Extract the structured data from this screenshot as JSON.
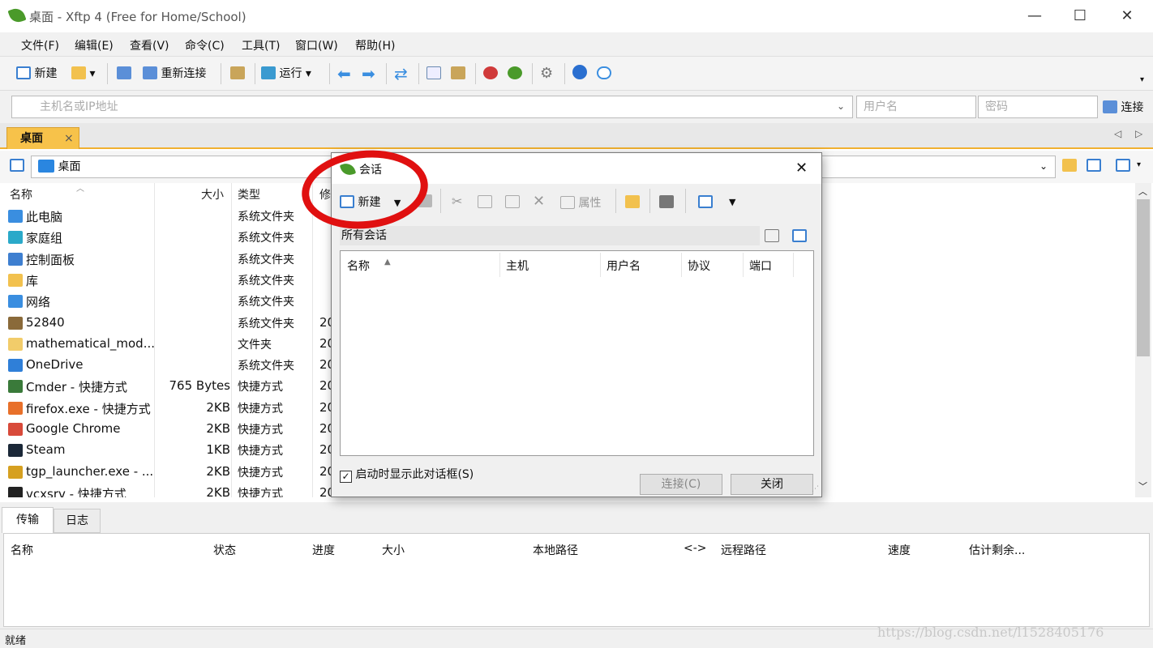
{
  "window": {
    "title": "桌面 - Xftp 4 (Free for Home/School)",
    "min": "—",
    "max": "☐",
    "close": "✕"
  },
  "menu": [
    "文件(F)",
    "编辑(E)",
    "查看(V)",
    "命令(C)",
    "工具(T)",
    "窗口(W)",
    "帮助(H)"
  ],
  "toolbar": {
    "new_label": "新建",
    "reconnect_label": "重新连接",
    "run_label": "运行"
  },
  "address": {
    "host_placeholder": "主机名或IP地址",
    "user_placeholder": "用户名",
    "pass_placeholder": "密码",
    "connect_label": "连接"
  },
  "tab": {
    "label": "桌面",
    "close": "×"
  },
  "path": {
    "value": "桌面"
  },
  "file_headers": {
    "name": "名称",
    "size": "大小",
    "type": "类型",
    "modified": "修"
  },
  "files": [
    {
      "name": "此电脑",
      "size": "",
      "type": "系统文件夹",
      "mod": "",
      "color": "#3a8ee0"
    },
    {
      "name": "家庭组",
      "size": "",
      "type": "系统文件夹",
      "mod": "",
      "color": "#2aa9c9"
    },
    {
      "name": "控制面板",
      "size": "",
      "type": "系统文件夹",
      "mod": "",
      "color": "#3e7fd0"
    },
    {
      "name": "库",
      "size": "",
      "type": "系统文件夹",
      "mod": "",
      "color": "#f2c14e"
    },
    {
      "name": "网络",
      "size": "",
      "type": "系统文件夹",
      "mod": "",
      "color": "#3a8ee0"
    },
    {
      "name": "52840",
      "size": "",
      "type": "系统文件夹",
      "mod": "20",
      "color": "#8a6a3a"
    },
    {
      "name": "mathematical_mod...",
      "size": "",
      "type": "文件夹",
      "mod": "20",
      "color": "#f2cc6a"
    },
    {
      "name": "OneDrive",
      "size": "",
      "type": "系统文件夹",
      "mod": "20",
      "color": "#2f7fd8"
    },
    {
      "name": "Cmder - 快捷方式",
      "size": "765 Bytes",
      "type": "快捷方式",
      "mod": "20",
      "color": "#3a7a3a"
    },
    {
      "name": "firefox.exe - 快捷方式",
      "size": "2KB",
      "type": "快捷方式",
      "mod": "20",
      "color": "#e8702a"
    },
    {
      "name": "Google Chrome",
      "size": "2KB",
      "type": "快捷方式",
      "mod": "20",
      "color": "#d84a3a"
    },
    {
      "name": "Steam",
      "size": "1KB",
      "type": "快捷方式",
      "mod": "20",
      "color": "#1b2838"
    },
    {
      "name": "tgp_launcher.exe - ...",
      "size": "2KB",
      "type": "快捷方式",
      "mod": "20",
      "color": "#d6a020"
    },
    {
      "name": "vcxsrv - 快捷方式",
      "size": "2KB",
      "type": "快捷方式",
      "mod": "20",
      "color": "#222222"
    }
  ],
  "bottom_tabs": {
    "transfer": "传输",
    "log": "日志"
  },
  "transfer_headers": [
    "名称",
    "状态",
    "进度",
    "大小",
    "本地路径",
    "<->",
    "远程路径",
    "速度",
    "估计剩余..."
  ],
  "status": "就绪",
  "watermark": "https://blog.csdn.net/l1528405176",
  "dialog": {
    "title": "会话",
    "close": "✕",
    "new_label": "新建",
    "props_label": "属性",
    "folder_label": "所有会话",
    "headers": {
      "name": "名称",
      "host": "主机",
      "user": "用户名",
      "protocol": "协议",
      "port": "端口"
    },
    "show_on_start": "启动时显示此对话框(S)",
    "connect_label": "连接(C)",
    "close_label": "关闭"
  }
}
